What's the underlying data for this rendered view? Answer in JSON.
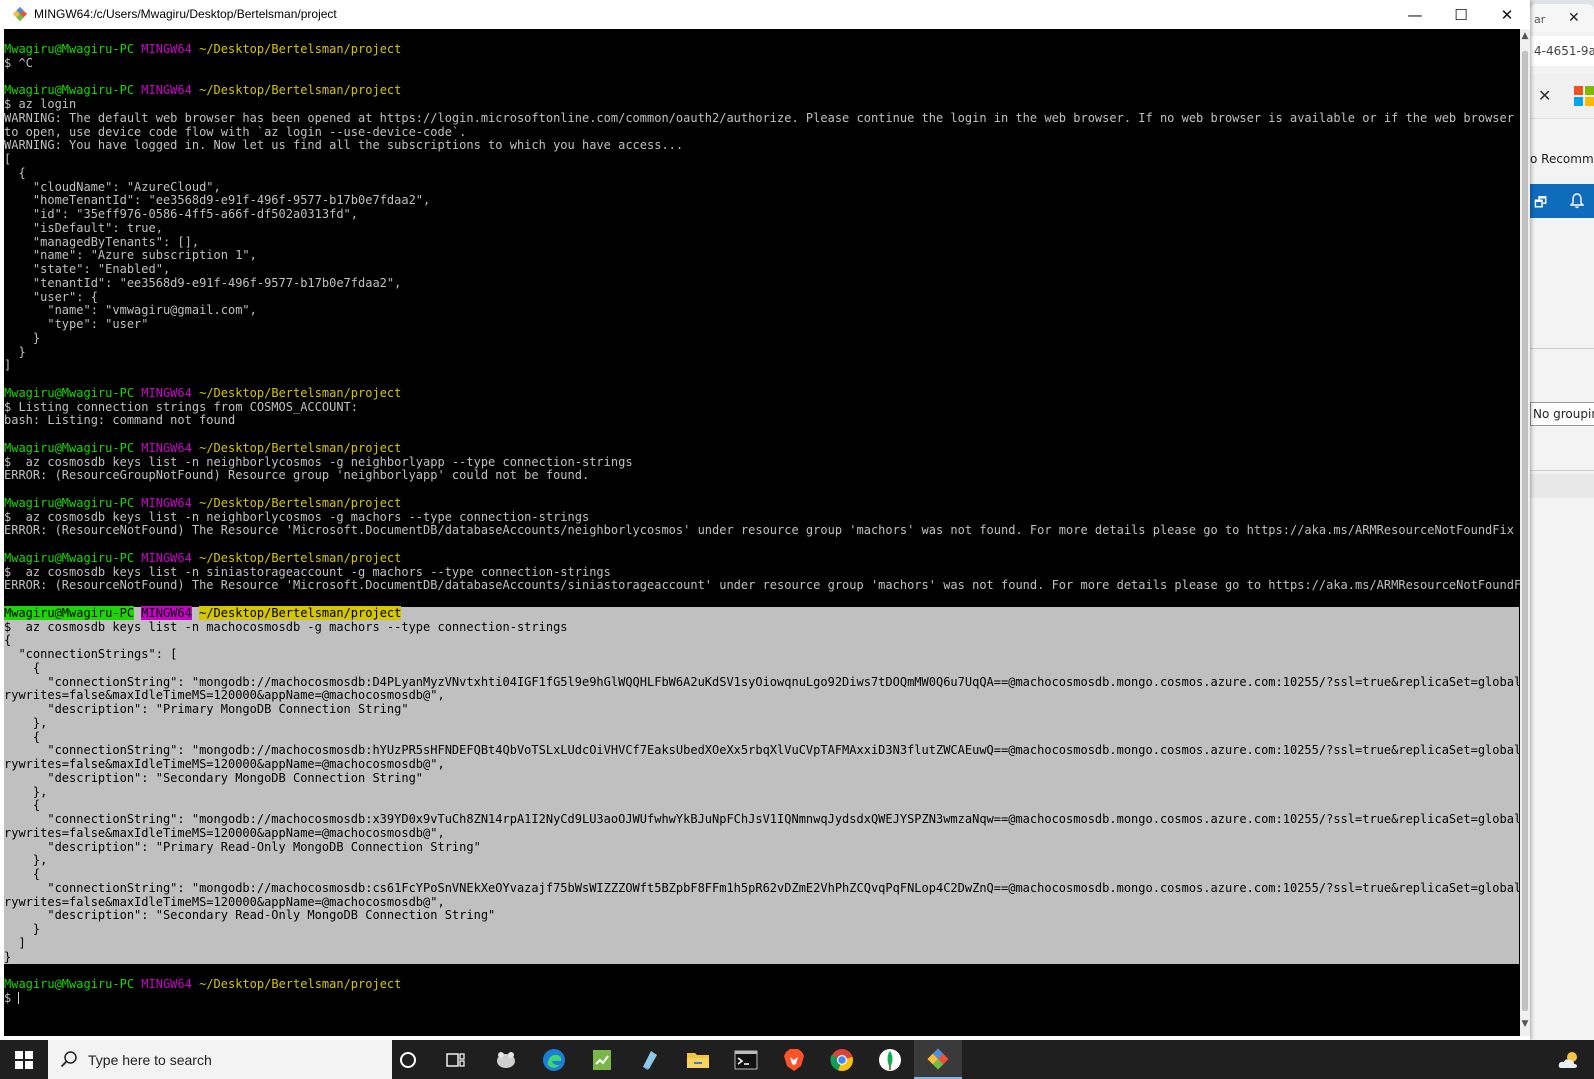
{
  "window": {
    "title": "MINGW64:/c/Users/Mwagiru/Desktop/Bertelsman/project",
    "minimize": "—",
    "maximize": "☐",
    "close": "✕"
  },
  "terminal": {
    "prompt": {
      "user_host": "Mwagiru@Mwagiru-PC",
      "shell": "MINGW64",
      "path": "~/Desktop/Bertelsman/project"
    },
    "line_groups": [
      {
        "type": "prompt"
      },
      {
        "type": "out",
        "text": "$ ^C"
      },
      {
        "type": "out",
        "text": ""
      },
      {
        "type": "prompt"
      },
      {
        "type": "out",
        "text": "$ az login"
      },
      {
        "type": "out",
        "text": "WARNING: The default web browser has been opened at https://login.microsoftonline.com/common/oauth2/authorize. Please continue the login in the web browser. If no web browser is available or if the web browser fails"
      },
      {
        "type": "out",
        "text": "to open, use device code flow with `az login --use-device-code`."
      },
      {
        "type": "out",
        "text": "WARNING: You have logged in. Now let us find all the subscriptions to which you have access..."
      },
      {
        "type": "out",
        "text": "["
      },
      {
        "type": "out",
        "text": "  {"
      },
      {
        "type": "out",
        "text": "    \"cloudName\": \"AzureCloud\","
      },
      {
        "type": "out",
        "text": "    \"homeTenantId\": \"ee3568d9-e91f-496f-9577-b17b0e7fdaa2\","
      },
      {
        "type": "out",
        "text": "    \"id\": \"35eff976-0586-4ff5-a66f-df502a0313fd\","
      },
      {
        "type": "out",
        "text": "    \"isDefault\": true,"
      },
      {
        "type": "out",
        "text": "    \"managedByTenants\": [],"
      },
      {
        "type": "out",
        "text": "    \"name\": \"Azure subscription 1\","
      },
      {
        "type": "out",
        "text": "    \"state\": \"Enabled\","
      },
      {
        "type": "out",
        "text": "    \"tenantId\": \"ee3568d9-e91f-496f-9577-b17b0e7fdaa2\","
      },
      {
        "type": "out",
        "text": "    \"user\": {"
      },
      {
        "type": "out",
        "text": "      \"name\": \"vmwagiru@gmail.com\","
      },
      {
        "type": "out",
        "text": "      \"type\": \"user\""
      },
      {
        "type": "out",
        "text": "    }"
      },
      {
        "type": "out",
        "text": "  }"
      },
      {
        "type": "out",
        "text": "]"
      },
      {
        "type": "out",
        "text": ""
      },
      {
        "type": "prompt"
      },
      {
        "type": "out",
        "text": "$ Listing connection strings from COSMOS_ACCOUNT:"
      },
      {
        "type": "out",
        "text": "bash: Listing: command not found"
      },
      {
        "type": "out",
        "text": ""
      },
      {
        "type": "prompt"
      },
      {
        "type": "out",
        "text": "$  az cosmosdb keys list -n neighborlycosmos -g neighborlyapp --type connection-strings"
      },
      {
        "type": "out",
        "text": "ERROR: (ResourceGroupNotFound) Resource group 'neighborlyapp' could not be found."
      },
      {
        "type": "out",
        "text": ""
      },
      {
        "type": "prompt"
      },
      {
        "type": "out",
        "text": "$  az cosmosdb keys list -n neighborlycosmos -g machors --type connection-strings"
      },
      {
        "type": "out",
        "text": "ERROR: (ResourceNotFound) The Resource 'Microsoft.DocumentDB/databaseAccounts/neighborlycosmos' under resource group 'machors' was not found. For more details please go to https://aka.ms/ARMResourceNotFoundFix"
      },
      {
        "type": "out",
        "text": ""
      },
      {
        "type": "prompt"
      },
      {
        "type": "out",
        "text": "$  az cosmosdb keys list -n siniastorageaccount -g machors --type connection-strings"
      },
      {
        "type": "out",
        "text": "ERROR: (ResourceNotFound) The Resource 'Microsoft.DocumentDB/databaseAccounts/siniastorageaccount' under resource group 'machors' was not found. For more details please go to https://aka.ms/ARMResourceNotFoundFix"
      },
      {
        "type": "out",
        "text": ""
      },
      {
        "type": "prompt",
        "selected": true
      },
      {
        "type": "out",
        "selected": true,
        "text": "$  az cosmosdb keys list -n machocosmosdb -g machors --type connection-strings"
      },
      {
        "type": "out",
        "selected": true,
        "text": "{"
      },
      {
        "type": "out",
        "selected": true,
        "text": "  \"connectionStrings\": ["
      },
      {
        "type": "out",
        "selected": true,
        "text": "    {"
      },
      {
        "type": "out",
        "selected": true,
        "text": "      \"connectionString\": \"mongodb://machocosmosdb:D4PLyanMyzVNvtxhti04IGF1fG5l9e9hGlWQQHLFbW6A2uKdSV1syOiowqnuLgo92Diws7tDOQmMW0Q6u7UqQA==@machocosmosdb.mongo.cosmos.azure.com:10255/?ssl=true&replicaSet=globaldb&ret"
      },
      {
        "type": "out",
        "selected": true,
        "text": "rywrites=false&maxIdleTimeMS=120000&appName=@machocosmosdb@\","
      },
      {
        "type": "out",
        "selected": true,
        "text": "      \"description\": \"Primary MongoDB Connection String\""
      },
      {
        "type": "out",
        "selected": true,
        "text": "    },"
      },
      {
        "type": "out",
        "selected": true,
        "text": "    {"
      },
      {
        "type": "out",
        "selected": true,
        "text": "      \"connectionString\": \"mongodb://machocosmosdb:hYUzPR5sHFNDEFQBt4QbVoTSLxLUdcOiVHVCf7EaksUbedXOeXx5rbqXlVuCVpTAFMAxxiD3N3flutZWCAEuwQ==@machocosmosdb.mongo.cosmos.azure.com:10255/?ssl=true&replicaSet=globaldb&ret"
      },
      {
        "type": "out",
        "selected": true,
        "text": "rywrites=false&maxIdleTimeMS=120000&appName=@machocosmosdb@\","
      },
      {
        "type": "out",
        "selected": true,
        "text": "      \"description\": \"Secondary MongoDB Connection String\""
      },
      {
        "type": "out",
        "selected": true,
        "text": "    },"
      },
      {
        "type": "out",
        "selected": true,
        "text": "    {"
      },
      {
        "type": "out",
        "selected": true,
        "text": "      \"connectionString\": \"mongodb://machocosmosdb:x39YD0x9vTuCh8ZN14rpA1I2NyCd9LU3aoOJWUfwhwYkBJuNpFChJsV1IQNmnwqJydsdxQWEJYSPZN3wmzaNqw==@machocosmosdb.mongo.cosmos.azure.com:10255/?ssl=true&replicaSet=globaldb&ret"
      },
      {
        "type": "out",
        "selected": true,
        "text": "rywrites=false&maxIdleTimeMS=120000&appName=@machocosmosdb@\","
      },
      {
        "type": "out",
        "selected": true,
        "text": "      \"description\": \"Primary Read-Only MongoDB Connection String\""
      },
      {
        "type": "out",
        "selected": true,
        "text": "    },"
      },
      {
        "type": "out",
        "selected": true,
        "text": "    {"
      },
      {
        "type": "out",
        "selected": true,
        "text": "      \"connectionString\": \"mongodb://machocosmosdb:cs61FcYPoSnVNEkXeOYvazajf75bWsWIZZZOWft5BZpbF8FFm1h5pR62vDZmE2VhPhZCQvqPqFNLop4C2DwZnQ==@machocosmosdb.mongo.cosmos.azure.com:10255/?ssl=true&replicaSet=globaldb&ret"
      },
      {
        "type": "out",
        "selected": true,
        "text": "rywrites=false&maxIdleTimeMS=120000&appName=@machocosmosdb@\","
      },
      {
        "type": "out",
        "selected": true,
        "text": "      \"description\": \"Secondary Read-Only MongoDB Connection String\""
      },
      {
        "type": "out",
        "selected": true,
        "text": "    }"
      },
      {
        "type": "out",
        "selected": true,
        "text": "  ]"
      },
      {
        "type": "out",
        "selected": true,
        "text": "}"
      },
      {
        "type": "out",
        "text": ""
      },
      {
        "type": "prompt"
      },
      {
        "type": "cursor",
        "text": "$ "
      }
    ]
  },
  "background_browser": {
    "tab_text": "ar",
    "tab_close": "✕",
    "url_text": "4-4651-9a",
    "close_text": "✕",
    "recommend_text": "o Recomm",
    "grouping_text": "No groupin",
    "colors": {
      "blue_bar": "#0f6cbd"
    }
  },
  "taskbar": {
    "search_placeholder": "Type here to search",
    "icons": [
      "windows-start-icon",
      "cortana-icon",
      "task-view-icon",
      "app-icon",
      "edge-icon",
      "notepad-icon",
      "app-icon",
      "file-explorer-icon",
      "terminal-icon",
      "brave-icon",
      "chrome-icon",
      "mongodb-compass-icon",
      "git-bash-icon",
      "weather-icon"
    ]
  }
}
